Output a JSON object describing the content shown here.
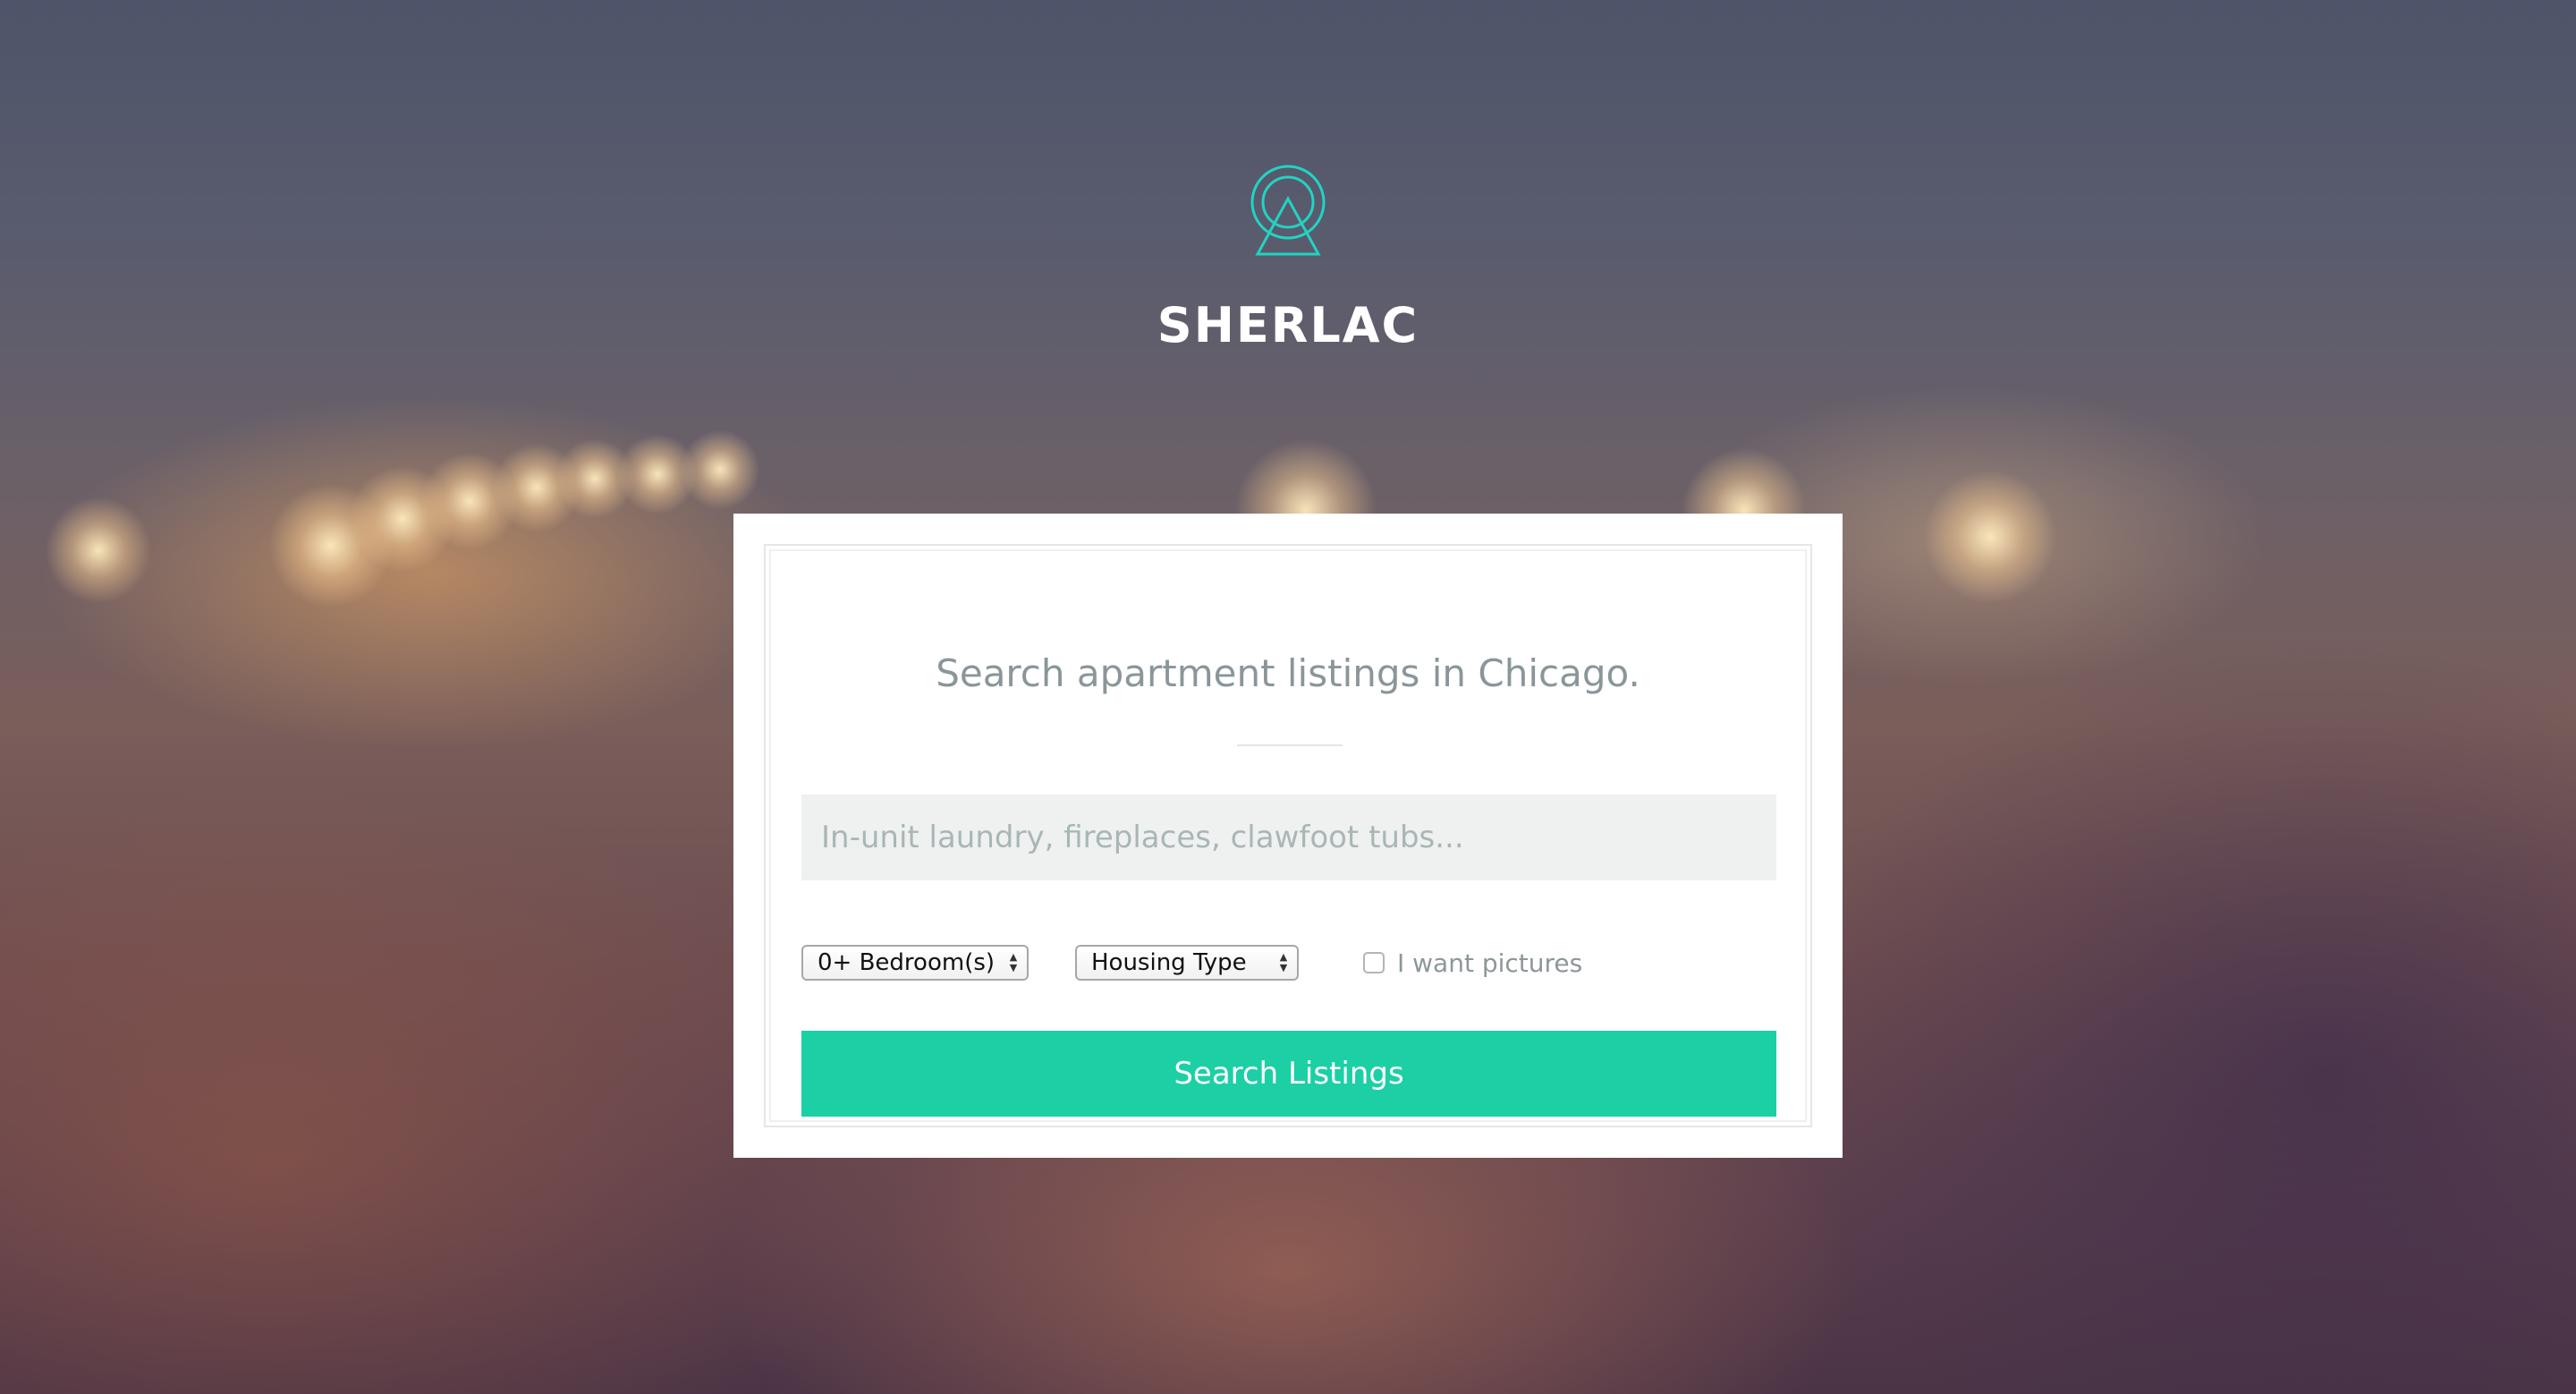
{
  "brand": {
    "name": "SHERLAC",
    "logo_icon": "circle-triangle-logo-icon",
    "accent_color": "#1ccfa5"
  },
  "search": {
    "headline": "Search apartment listings in Chicago.",
    "placeholder": "In-unit laundry, fireplaces, clawfoot tubs...",
    "value": ""
  },
  "filters": {
    "bedrooms_selected": "0+ Bedroom(s)",
    "housing_type_selected": "Housing Type",
    "pictures_label": "I want pictures",
    "pictures_checked": false
  },
  "actions": {
    "search_button_label": "Search Listings"
  }
}
